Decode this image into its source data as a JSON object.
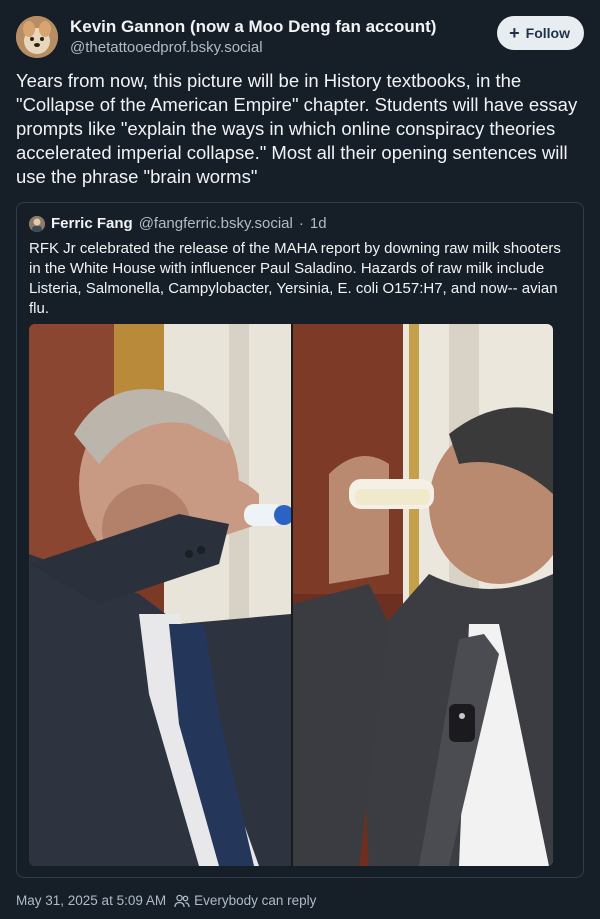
{
  "post": {
    "author": {
      "display_name": "Kevin Gannon (now a Moo Deng fan account)",
      "handle": "@thetattooedprof.bsky.social",
      "avatar_icon": "dog-avatar-icon"
    },
    "follow_label": "Follow",
    "text": "Years from now, this picture will be in History textbooks, in the \"Collapse of the American Empire\" chapter. Students will have essay prompts like \"explain the ways in which online conspiracy theories accelerated imperial collapse.\" Most all their opening sentences will use the phrase \"brain worms\"",
    "quote": {
      "author_name": "Ferric Fang",
      "handle": "@fangferric.bsky.social",
      "separator": "·",
      "time_ago": "1d",
      "text": "RFK Jr celebrated the release of the MAHA report by downing raw milk shooters in the White House with influencer Paul Saladino. Hazards of raw milk include Listeria, Salmonella, Campylobacter, Yersinia, E. coli O157:H7, and now-- avian flu."
    },
    "footer": {
      "timestamp": "May 31, 2025 at 5:09 AM",
      "reply_setting": "Everybody can reply"
    }
  },
  "colors": {
    "background": "#161e27",
    "text_primary": "#f1f3f5",
    "text_secondary": "#aebbc9",
    "follow_button_bg": "#e8edf2",
    "follow_button_text": "#1f3347",
    "border": "#2e3d4d"
  }
}
